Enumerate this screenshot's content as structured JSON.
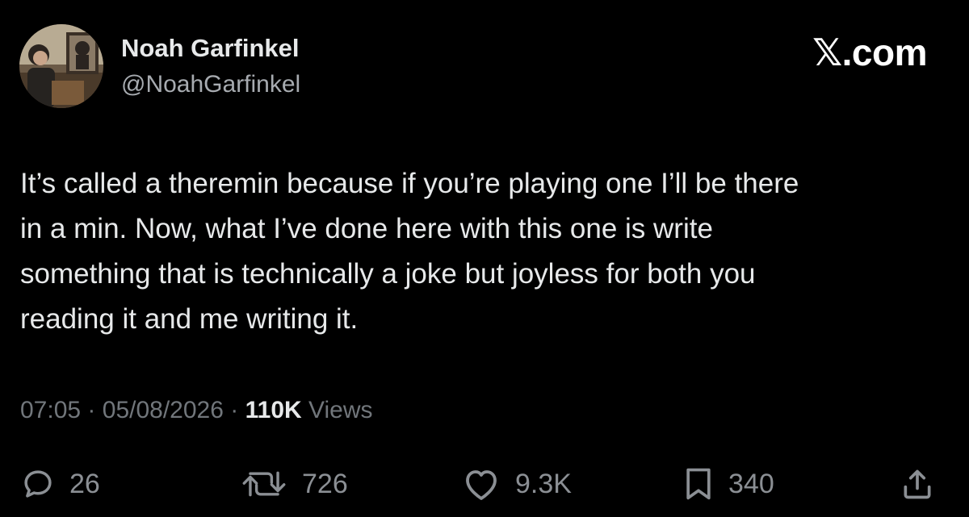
{
  "author": {
    "display_name": "Noah Garfinkel",
    "handle": "@NoahGarfinkel",
    "avatar_icon": "profile-photo-avatar"
  },
  "brand": {
    "mark": "𝕏",
    "suffix": ".com"
  },
  "tweet": {
    "lines": [
      "It’s called a theremin because if you’re playing one I’ll be there",
      "in a min. Now, what I’ve done here with this one is write",
      "something that is technically a joke but joyless for both you",
      "reading it and me writing it."
    ]
  },
  "meta": {
    "time": "07:05",
    "separator": "·",
    "date": "05/08/2026",
    "views_count": "110K",
    "views_label": "Views"
  },
  "actions": {
    "replies": {
      "icon": "reply-bubble-icon",
      "count": "26"
    },
    "reposts": {
      "icon": "repost-icon",
      "count": "726"
    },
    "likes": {
      "icon": "heart-icon",
      "count": "9.3K"
    },
    "bookmarks": {
      "icon": "bookmark-icon",
      "count": "340"
    },
    "share": {
      "icon": "share-icon"
    }
  },
  "colors": {
    "background": "#000000",
    "primary_text": "#e7e9ea",
    "secondary_text": "#71767b",
    "icon": "#8b8f94"
  }
}
